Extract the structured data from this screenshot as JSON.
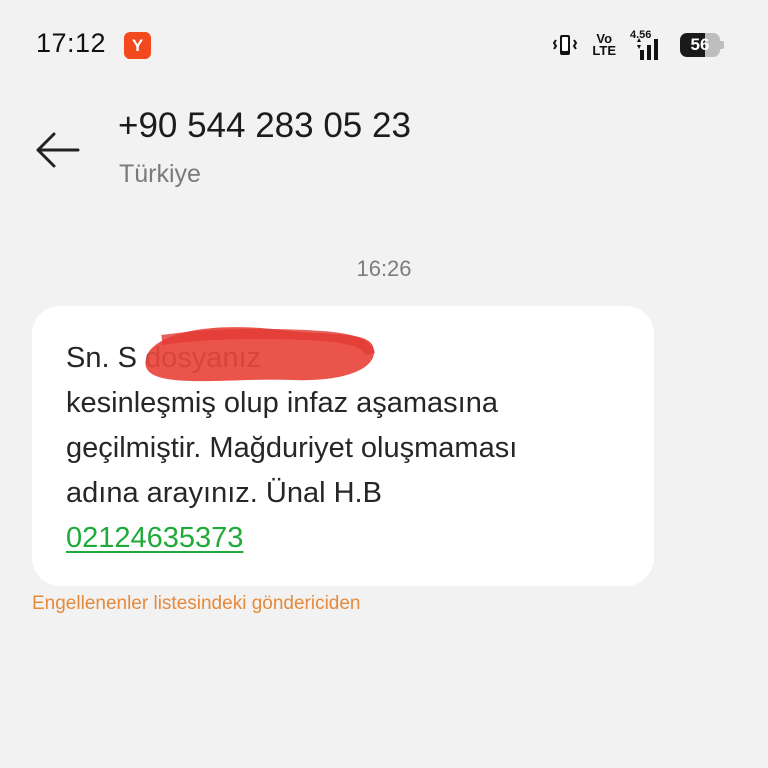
{
  "status_bar": {
    "time": "17:12",
    "app_badge": "Y",
    "volte_top": "Vo",
    "volte_bottom": "LTE",
    "network_speed": "4.56",
    "battery_level": "56"
  },
  "header": {
    "contact_number": "+90 544 283 05 23",
    "contact_region": "Türkiye"
  },
  "conversation": {
    "timestamp": "16:26",
    "message": {
      "text": "Sn. S                          dosyanız\nkesinleşmiş olup infaz aşamasına\ngeçilmiştir. Mağduriyet oluşmaması\nadına arayınız. Ünal H.B",
      "link_number": "02124635373"
    },
    "blocked_notice": "Engellenenler listesindeki göndericiden"
  },
  "colors": {
    "background": "#f2f2f2",
    "bubble": "#ffffff",
    "link": "#1faa3a",
    "blocked_notice": "#e58a3a",
    "app_badge": "#f4481f",
    "redaction": "#e8453c"
  }
}
